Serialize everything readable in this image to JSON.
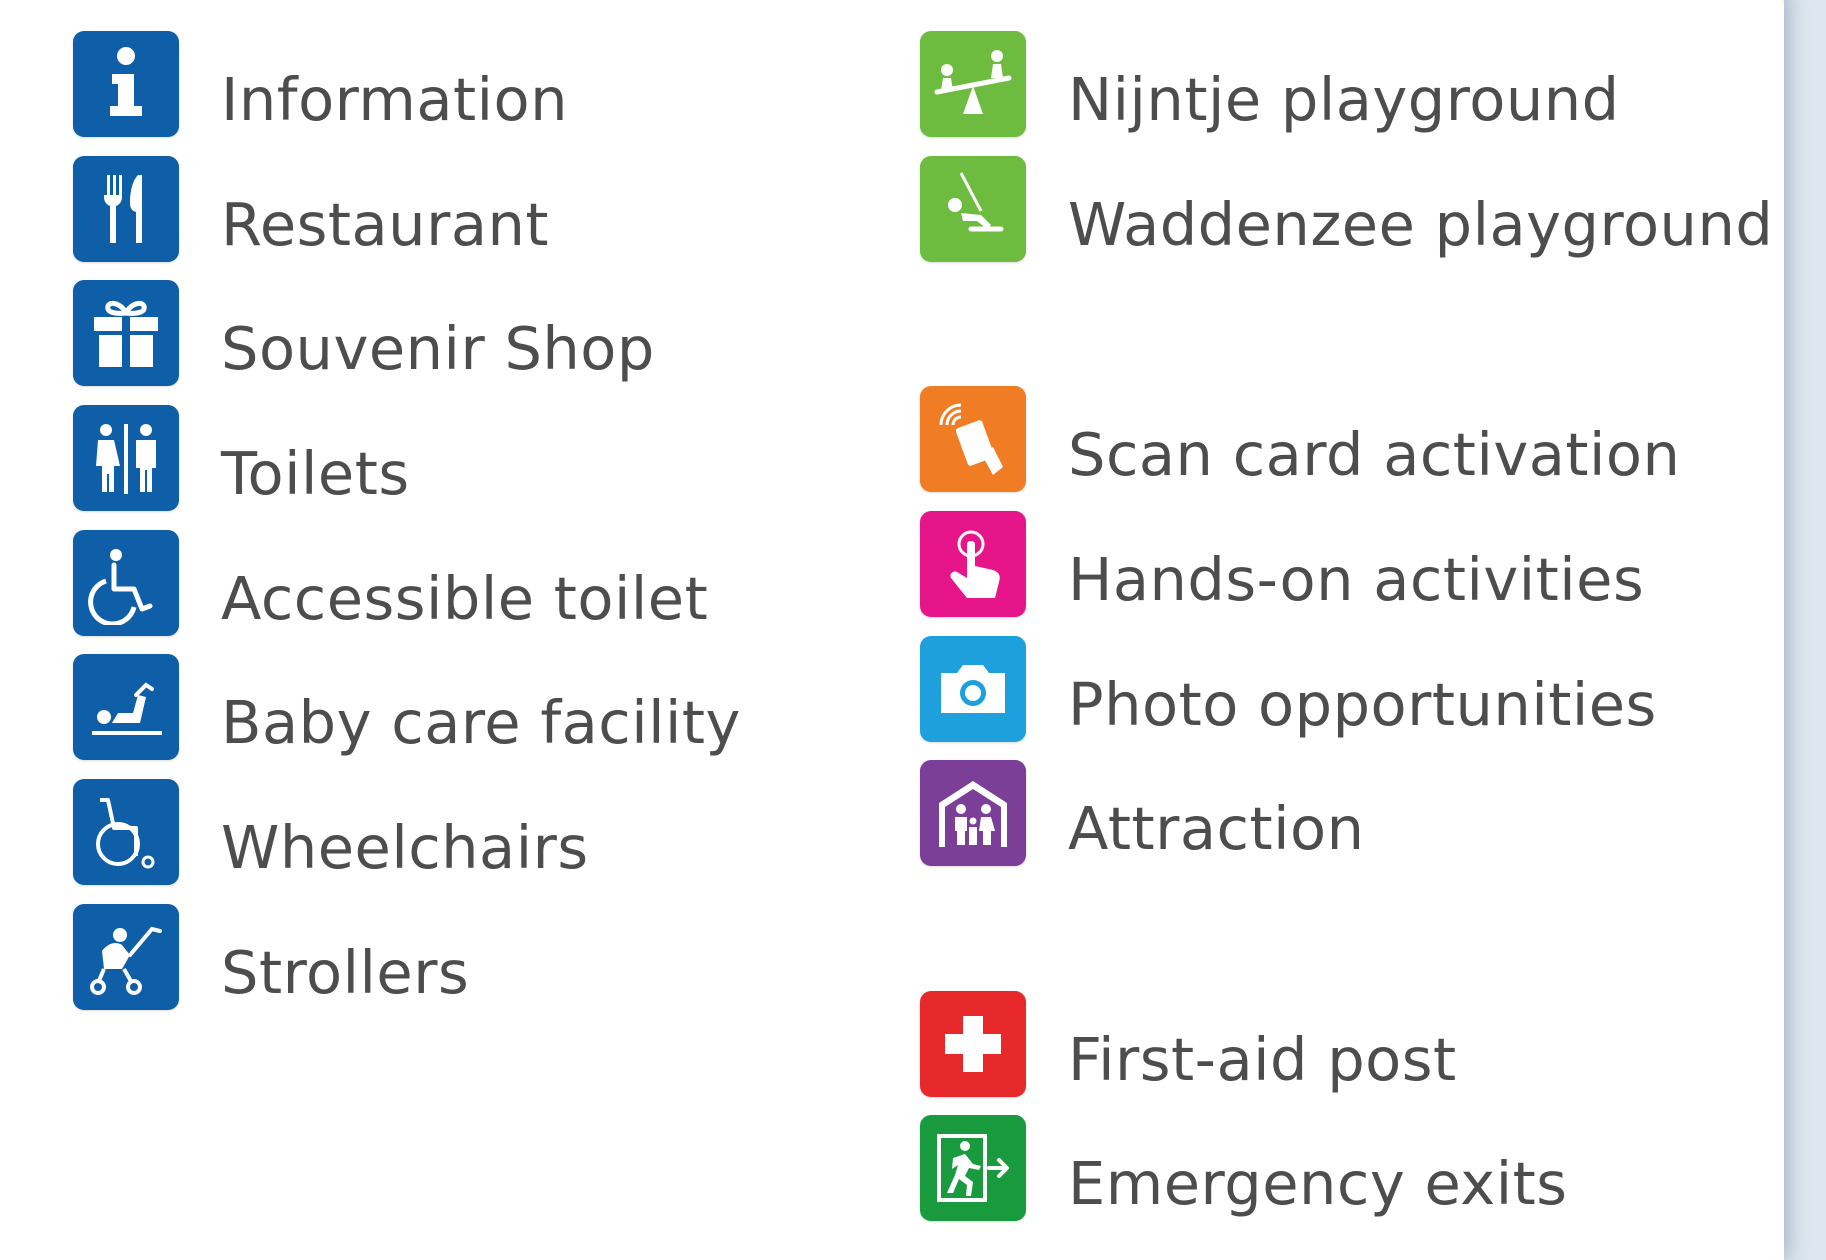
{
  "left_column": [
    {
      "label": "Information",
      "icon": "information-icon",
      "color": "#0e5ea8"
    },
    {
      "label": "Restaurant",
      "icon": "restaurant-icon",
      "color": "#0e5ea8"
    },
    {
      "label": "Souvenir Shop",
      "icon": "gift-icon",
      "color": "#0e5ea8"
    },
    {
      "label": "Toilets",
      "icon": "toilets-icon",
      "color": "#0e5ea8"
    },
    {
      "label": "Accessible toilet",
      "icon": "accessible-toilet-icon",
      "color": "#0e5ea8"
    },
    {
      "label": "Baby care facility",
      "icon": "baby-care-icon",
      "color": "#0e5ea8"
    },
    {
      "label": "Wheelchairs",
      "icon": "wheelchair-icon",
      "color": "#0e5ea8"
    },
    {
      "label": "Strollers",
      "icon": "stroller-icon",
      "color": "#0e5ea8"
    }
  ],
  "right_column": [
    {
      "label": "Nijntje playground",
      "icon": "seesaw-icon",
      "color": "#6dbb3f"
    },
    {
      "label": "Waddenzee playground",
      "icon": "swing-icon",
      "color": "#6dbb3f"
    },
    {
      "label": "Scan card activation",
      "icon": "scan-card-icon",
      "color": "#f07d24"
    },
    {
      "label": "Hands-on activities",
      "icon": "touch-hand-icon",
      "color": "#e6168a"
    },
    {
      "label": "Photo opportunities",
      "icon": "camera-icon",
      "color": "#1ea0dc"
    },
    {
      "label": "Attraction",
      "icon": "family-house-icon",
      "color": "#7b3f98"
    },
    {
      "label": "First-aid post",
      "icon": "first-aid-cross-icon",
      "color": "#e8292b"
    },
    {
      "label": "Emergency exits",
      "icon": "emergency-exit-icon",
      "color": "#1a9a3e"
    }
  ]
}
